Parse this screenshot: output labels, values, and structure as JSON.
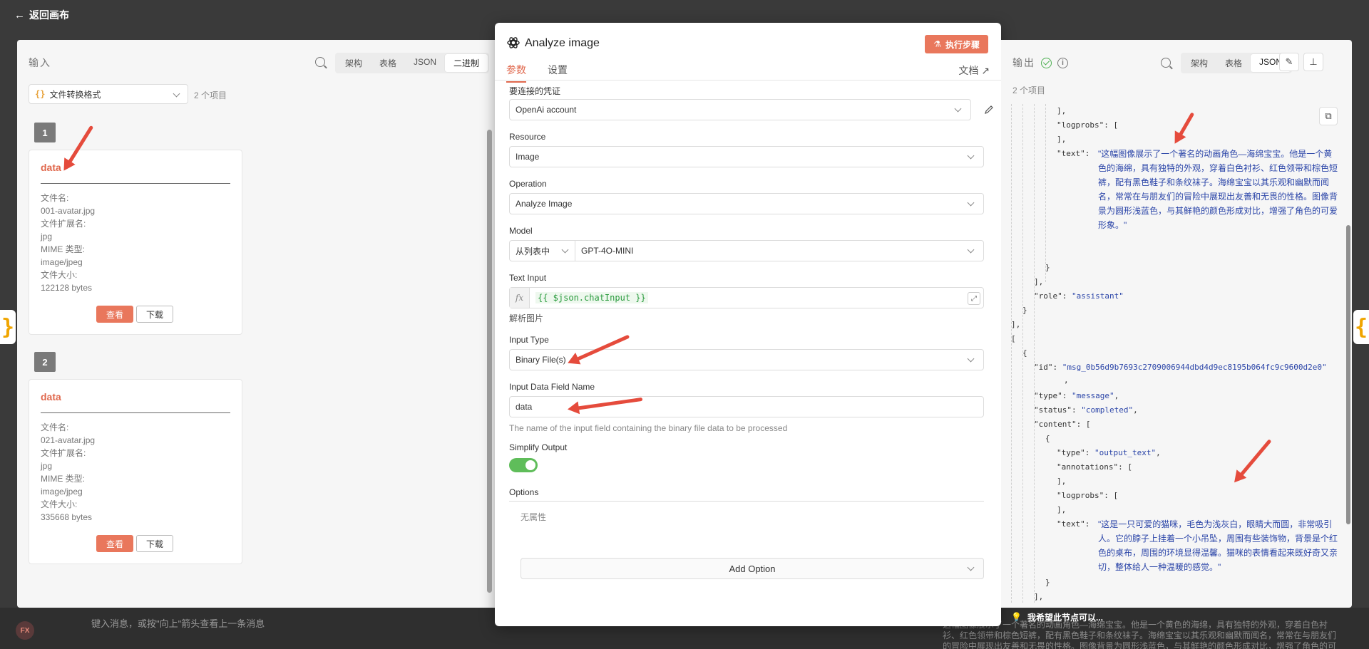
{
  "top": {
    "back_label": "返回画布"
  },
  "input_panel": {
    "title": "输入",
    "view_tabs": [
      "架构",
      "表格",
      "JSON",
      "二进制"
    ],
    "active_tab": "二进制",
    "node_select": "文件转换格式",
    "item_count": "2 个项目",
    "items": [
      {
        "index": "1",
        "title": "data",
        "file_name_label": "文件名:",
        "file_name": "001-avatar.jpg",
        "ext_label": "文件扩展名:",
        "ext": "jpg",
        "mime_label": "MIME 类型:",
        "mime": "image/jpeg",
        "size_label": "文件大小:",
        "size": "122128 bytes",
        "view_label": "查看",
        "download_label": "下载"
      },
      {
        "index": "2",
        "title": "data",
        "file_name_label": "文件名:",
        "file_name": "021-avatar.jpg",
        "ext_label": "文件扩展名:",
        "ext": "jpg",
        "mime_label": "MIME 类型:",
        "mime": "image/jpeg",
        "size_label": "文件大小:",
        "size": "335668 bytes",
        "view_label": "查看",
        "download_label": "下载"
      }
    ]
  },
  "ndv": {
    "title": "Analyze image",
    "execute_label": "执行步骤",
    "tabs": [
      "参数",
      "设置"
    ],
    "active_tab": "参数",
    "docs_label": "文档",
    "credential_label": "要连接的凭证",
    "credential_value": "OpenAi account",
    "resource_label": "Resource",
    "resource_value": "Image",
    "operation_label": "Operation",
    "operation_value": "Analyze Image",
    "model_label": "Model",
    "model_mode": "从列表中",
    "model_value": "GPT-4O-MINI",
    "text_input_label": "Text Input",
    "text_input_expr": "{{ $json.chatInput }}",
    "text_input_result": "解析图片",
    "input_type_label": "Input Type",
    "input_type_value": "Binary File(s)",
    "field_name_label": "Input Data Field Name",
    "field_name_value": "data",
    "field_name_hint": "The name of the input field containing the binary file data to be processed",
    "simplify_label": "Simplify Output",
    "simplify_on": true,
    "options_label": "Options",
    "no_props": "无属性",
    "add_option_label": "Add Option"
  },
  "output_panel": {
    "title": "输出",
    "view_tabs": [
      "架构",
      "表格",
      "JSON"
    ],
    "active_tab": "JSON",
    "item_count": "2 个项目",
    "json": {
      "text1": "\"这幅图像展示了一个著名的动画角色—海绵宝宝。他是一个黄色的海绵，具有独特的外观，穿着白色衬衫、红色领带和棕色短裤，配有黑色鞋子和条纹袜子。海绵宝宝以其乐观和幽默而闻名，常常在与朋友们的冒险中展现出友善和无畏的性格。图像背景为圆形浅蓝色，与其鲜艳的颜色形成对比，增强了角色的可爱形象。\"",
      "role": "\"assistant\"",
      "id": "\"msg_0b56d9b7693c2709006944dbd4d9ec8195b064fc9c9600d2e0\"",
      "type_message": "\"message\"",
      "status": "\"completed\"",
      "type_output": "\"output_text\"",
      "text2": "\"这是一只可爱的猫咪，毛色为浅灰白，眼睛大而圆，非常吸引人。它的脖子上挂着一个小吊坠，周围有些装饰物，背景是个红色的桌布，周围的环境显得温馨。猫咪的表情看起来既好奇又亲切，整体给人一种温暖的感觉。\"",
      "keys": {
        "logprobs": "\"logprobs\":",
        "text": "\"text\":",
        "role": "\"role\":",
        "id": "\"id\":",
        "type": "\"type\":",
        "status": "\"status\":",
        "content": "\"content\":",
        "annotations": "\"annotations\":"
      }
    }
  },
  "hint_bar": {
    "text": "我希望此节点可以..."
  },
  "chat": {
    "placeholder": "键入消息，或按\"向上\"箭头查看上一条消息",
    "avatar": "FX",
    "bg_text": "这幅图像展示了一个著名的动画角色—海绵宝宝。他是一个黄色的海绵，具有独特的外观，穿着白色衬衫、红色领带和棕色短裤，配有黑色鞋子和条纹袜子。海绵宝宝以其乐观和幽默而闻名，常常在与朋友们的冒险中展现出友善和无畏的性格。图像背景为圆形浅蓝色，与其鲜艳的颜色形成对比，增强了角色的可爱形象。"
  },
  "colors": {
    "accent": "#e9775c",
    "success": "#5fbd5a",
    "json_string": "#2b45a8"
  }
}
